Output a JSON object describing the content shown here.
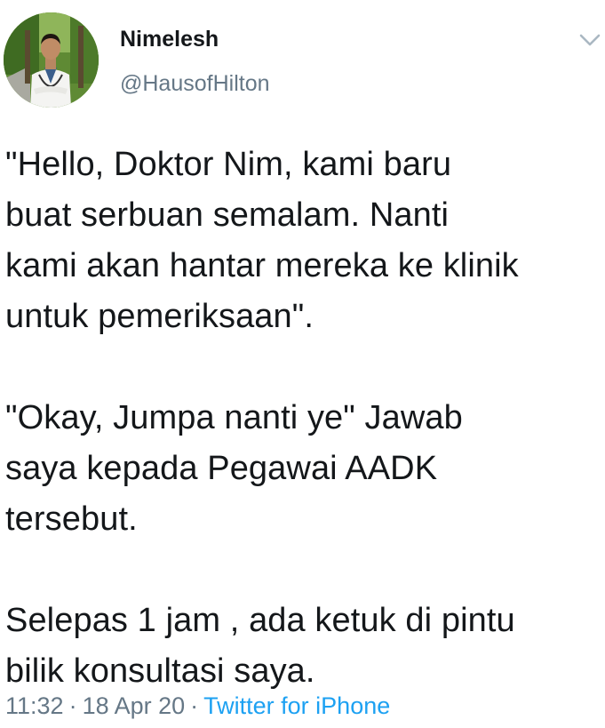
{
  "author": {
    "display_name": "Nimelesh",
    "handle": "@HausofHilton",
    "avatar_icon": "doctor-portrait-avatar"
  },
  "menu_icon": "chevron-down-icon",
  "tweet": {
    "paragraphs": [
      "\"Hello, Doktor Nim, kami baru\nbuat serbuan semalam. Nanti\nkami akan hantar mereka ke klinik\nuntuk pemeriksaan\".",
      "\"Okay, Jumpa nanti ye\" Jawab\nsaya kepada Pegawai AADK\ntersebut.",
      "Selepas 1 jam , ada ketuk di pintu\nbilik konsultasi saya."
    ]
  },
  "meta": {
    "time": "11:32",
    "separator": "·",
    "date": "18 Apr 20",
    "source": "Twitter for iPhone"
  },
  "colors": {
    "text": "#14171a",
    "secondary": "#657786",
    "link": "#1da1f2"
  }
}
